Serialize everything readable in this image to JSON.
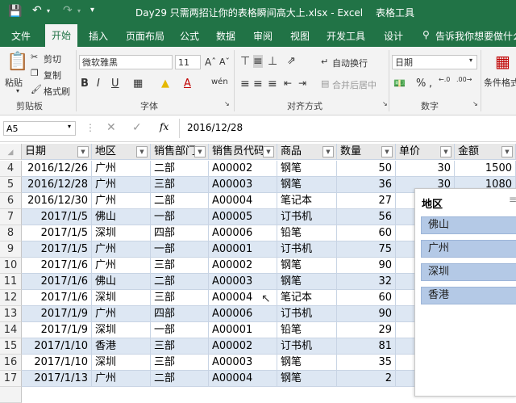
{
  "window": {
    "title": "Day29 只需两招让你的表格瞬间高大上.xlsx - Excel",
    "contextual_tab": "表格工具"
  },
  "ribbon_tabs": [
    "文件",
    "开始",
    "插入",
    "页面布局",
    "公式",
    "数据",
    "审阅",
    "视图",
    "开发工具",
    "设计"
  ],
  "tell_me": "告诉我你想要做什么",
  "clipboard": {
    "paste": "粘贴",
    "cut": "剪切",
    "copy": "复制",
    "format_painter": "格式刷",
    "label": "剪贴板"
  },
  "font": {
    "name": "微软雅黑",
    "size": "11",
    "label": "字体",
    "bold": "B",
    "italic": "I",
    "underline": "U"
  },
  "alignment": {
    "wrap": "自动换行",
    "merge": "合并后居中",
    "label": "对齐方式"
  },
  "number": {
    "format": "日期",
    "label": "数字",
    "percent": "%"
  },
  "styles": {
    "conditional": "条件格式"
  },
  "formula_bar": {
    "name_box": "A5",
    "formula": "2016/12/28",
    "fx": "fx"
  },
  "headers": [
    "日期",
    "地区",
    "销售部门",
    "销售员代码",
    "商品",
    "数量",
    "单价",
    "金额"
  ],
  "rows": [
    {
      "n": "4",
      "date": "2016/12/26",
      "region": "广州",
      "dept": "二部",
      "code": "A00002",
      "item": "钢笔",
      "qty": "50",
      "price": "30",
      "amount": "1500"
    },
    {
      "n": "5",
      "date": "2016/12/28",
      "region": "广州",
      "dept": "三部",
      "code": "A00003",
      "item": "钢笔",
      "qty": "36",
      "price": "30",
      "amount": "1080"
    },
    {
      "n": "6",
      "date": "2016/12/30",
      "region": "广州",
      "dept": "二部",
      "code": "A00004",
      "item": "笔记本",
      "qty": "27",
      "price": "",
      "amount": ""
    },
    {
      "n": "7",
      "date": "2017/1/5",
      "region": "佛山",
      "dept": "一部",
      "code": "A00005",
      "item": "订书机",
      "qty": "56",
      "price": "",
      "amount": ""
    },
    {
      "n": "8",
      "date": "2017/1/5",
      "region": "深圳",
      "dept": "四部",
      "code": "A00006",
      "item": "铅笔",
      "qty": "60",
      "price": "",
      "amount": ""
    },
    {
      "n": "9",
      "date": "2017/1/5",
      "region": "广州",
      "dept": "一部",
      "code": "A00001",
      "item": "订书机",
      "qty": "75",
      "price": "",
      "amount": ""
    },
    {
      "n": "10",
      "date": "2017/1/6",
      "region": "广州",
      "dept": "三部",
      "code": "A00002",
      "item": "钢笔",
      "qty": "90",
      "price": "",
      "amount": ""
    },
    {
      "n": "11",
      "date": "2017/1/6",
      "region": "佛山",
      "dept": "二部",
      "code": "A00003",
      "item": "钢笔",
      "qty": "32",
      "price": "",
      "amount": ""
    },
    {
      "n": "12",
      "date": "2017/1/6",
      "region": "深圳",
      "dept": "三部",
      "code": "A00004",
      "item": "笔记本",
      "qty": "60",
      "price": "",
      "amount": ""
    },
    {
      "n": "13",
      "date": "2017/1/9",
      "region": "广州",
      "dept": "四部",
      "code": "A00006",
      "item": "订书机",
      "qty": "90",
      "price": "",
      "amount": ""
    },
    {
      "n": "14",
      "date": "2017/1/9",
      "region": "深圳",
      "dept": "一部",
      "code": "A00001",
      "item": "铅笔",
      "qty": "29",
      "price": "",
      "amount": ""
    },
    {
      "n": "15",
      "date": "2017/1/10",
      "region": "香港",
      "dept": "三部",
      "code": "A00002",
      "item": "订书机",
      "qty": "81",
      "price": "",
      "amount": ""
    },
    {
      "n": "16",
      "date": "2017/1/10",
      "region": "深圳",
      "dept": "三部",
      "code": "A00003",
      "item": "钢笔",
      "qty": "35",
      "price": "",
      "amount": ""
    },
    {
      "n": "17",
      "date": "2017/1/13",
      "region": "广州",
      "dept": "二部",
      "code": "A00004",
      "item": "钢笔",
      "qty": "2",
      "price": "",
      "amount": ""
    }
  ],
  "slicer": {
    "title": "地区",
    "items": [
      "佛山",
      "广州",
      "深圳",
      "香港"
    ]
  },
  "colors": {
    "excel_green": "#217346",
    "band": "#dde7f3",
    "slicer_item": "#b4c9e6"
  }
}
